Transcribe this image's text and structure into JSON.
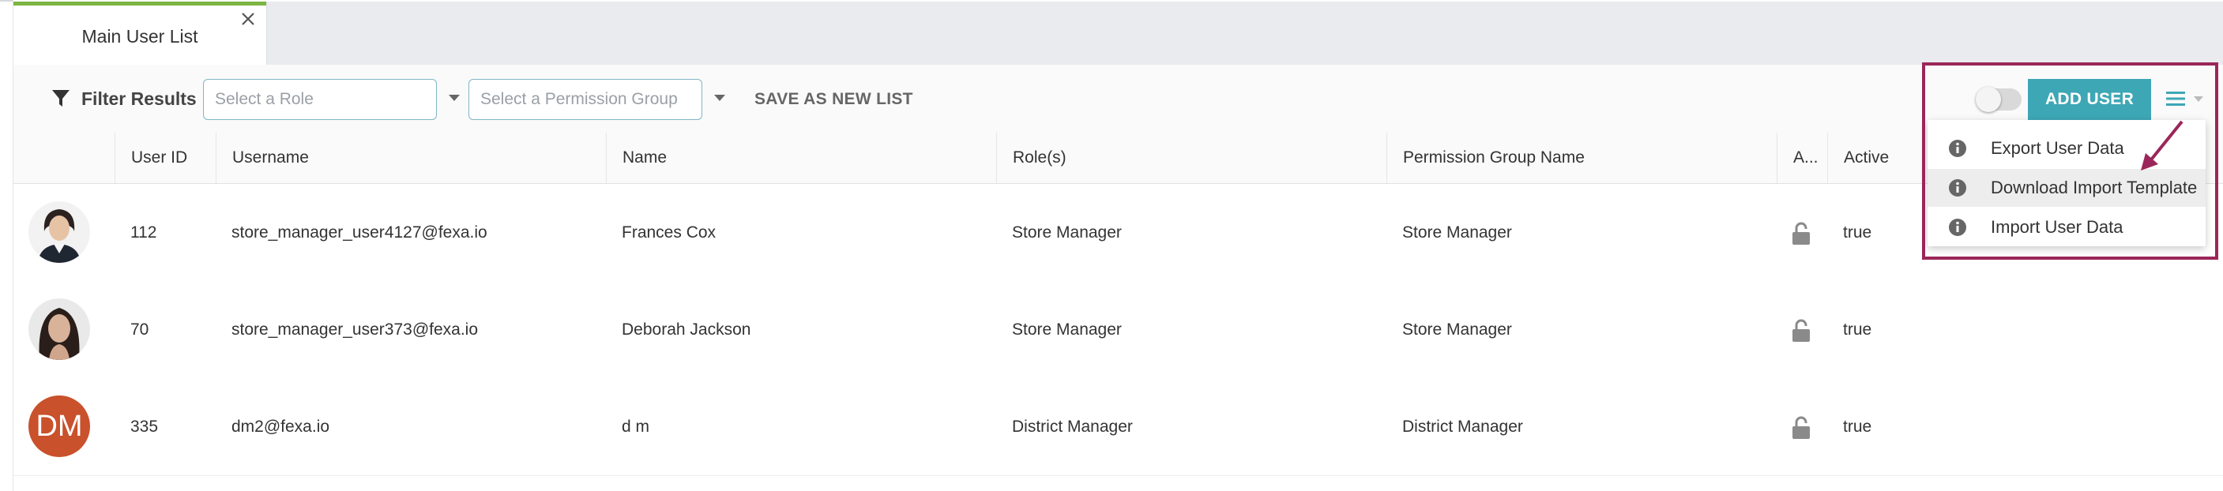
{
  "tabs": [
    {
      "label": "Main User List"
    }
  ],
  "toolbar": {
    "filter_label": "Filter Results",
    "role_placeholder": "Select a Role",
    "permission_placeholder": "Select a Permission Group",
    "save_list_label": "SAVE AS NEW LIST",
    "add_user_label": "ADD USER"
  },
  "table": {
    "headers": [
      "",
      "User ID",
      "Username",
      "Name",
      "Role(s)",
      "Permission Group Name",
      "A...",
      "Active"
    ],
    "rows": [
      {
        "avatar": "photo-woman-smiling",
        "user_id": "112",
        "username": "store_manager_user4127@fexa.io",
        "name": "Frances Cox",
        "roles": "Store Manager",
        "permission_group": "Store Manager",
        "lock": "unlock-icon",
        "active": "true"
      },
      {
        "avatar": "photo-woman-dark-hair",
        "user_id": "70",
        "username": "store_manager_user373@fexa.io",
        "name": "Deborah Jackson",
        "roles": "Store Manager",
        "permission_group": "Store Manager",
        "lock": "unlock-icon",
        "active": "true"
      },
      {
        "avatar_initials": "DM",
        "user_id": "335",
        "username": "dm2@fexa.io",
        "name": "d m",
        "roles": "District Manager",
        "permission_group": "District Manager",
        "lock": "unlock-icon",
        "active": "true"
      }
    ]
  },
  "dropdown": {
    "items": [
      {
        "label": "Export User Data",
        "icon": "info-icon"
      },
      {
        "label": "Download Import Template",
        "icon": "info-icon",
        "hovered": true
      },
      {
        "label": "Import User Data",
        "icon": "info-icon"
      }
    ]
  },
  "colors": {
    "accent": "#3ea7b5",
    "tab_indicator": "#7db544",
    "annotation": "#9b2659",
    "initials_avatar": "#c9512c"
  }
}
